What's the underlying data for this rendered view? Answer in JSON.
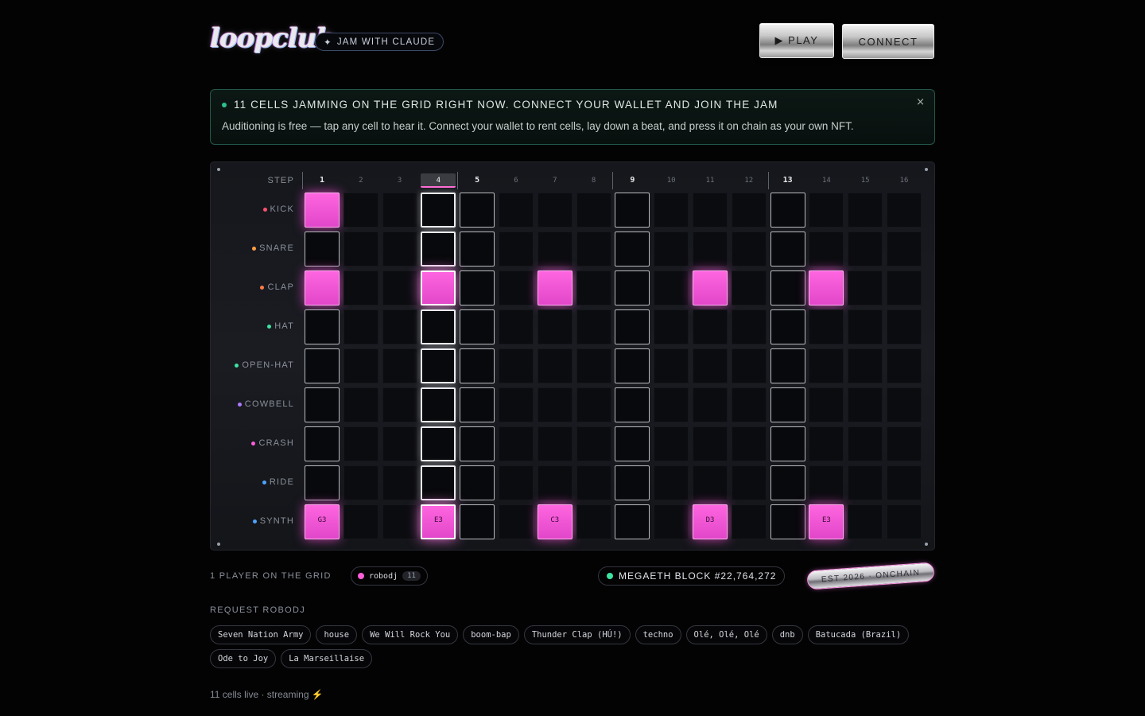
{
  "header": {
    "logo_text": "loopclub",
    "jam_pill_icon": "✦",
    "jam_pill_label": "JAM WITH CLAUDE",
    "play_label": "▶ PLAY",
    "connect_label": "CONNECT"
  },
  "banner": {
    "title": "11 CELLS JAMMING ON THE GRID RIGHT NOW. CONNECT YOUR WALLET AND JOIN THE JAM",
    "text": "Auditioning is free — tap any cell to hear it. Connect your wallet to rent cells, lay down a beat, and press it on chain as your own NFT.",
    "close_label": "×",
    "dot_color": "#2fbf8f"
  },
  "grid": {
    "step_label": "STEP",
    "steps": [
      "1",
      "2",
      "3",
      "4",
      "5",
      "6",
      "7",
      "8",
      "9",
      "10",
      "11",
      "12",
      "13",
      "14",
      "15",
      "16"
    ],
    "major_steps": [
      1,
      5,
      9,
      13
    ],
    "playhead_step": 4,
    "tracks": [
      {
        "name": "KICK",
        "color": "#ff4f6e"
      },
      {
        "name": "SNARE",
        "color": "#ff9f43"
      },
      {
        "name": "CLAP",
        "color": "#ff7a45"
      },
      {
        "name": "HAT",
        "color": "#3ee3a1"
      },
      {
        "name": "OPEN-HAT",
        "color": "#3ee3a1"
      },
      {
        "name": "COWBELL",
        "color": "#b07aff"
      },
      {
        "name": "CRASH",
        "color": "#ff5ed8"
      },
      {
        "name": "RIDE",
        "color": "#4fa3ff"
      },
      {
        "name": "SYNTH",
        "color": "#4fa3ff"
      }
    ],
    "active_cells": [
      {
        "track": 0,
        "step": 1
      },
      {
        "track": 2,
        "step": 1
      },
      {
        "track": 2,
        "step": 4
      },
      {
        "track": 2,
        "step": 7
      },
      {
        "track": 2,
        "step": 11
      },
      {
        "track": 2,
        "step": 14
      },
      {
        "track": 8,
        "step": 1,
        "note": "G3"
      },
      {
        "track": 8,
        "step": 4,
        "note": "E3"
      },
      {
        "track": 8,
        "step": 7,
        "note": "C3"
      },
      {
        "track": 8,
        "step": 11,
        "note": "D3"
      },
      {
        "track": 8,
        "step": 14,
        "note": "E3"
      }
    ]
  },
  "footer": {
    "players_label": "1 PLAYER ON THE GRID",
    "player_name": "robodj",
    "player_count": "11",
    "player_color": "#ff5ed8",
    "block_label": "MEGAETH BLOCK #22,764,272",
    "block_dot_color": "#3ee3a1",
    "est_badge": "EST 2026 · ONCHAIN",
    "request_label": "REQUEST ROBODJ",
    "requests": [
      "Seven Nation Army",
      "house",
      "We Will Rock You",
      "boom-bap",
      "Thunder Clap (HÚ!)",
      "techno",
      "Olé, Olé, Olé",
      "dnb",
      "Batucada (Brazil)",
      "Ode to Joy",
      "La Marseillaise"
    ],
    "status": "11 cells live · streaming ⚡"
  }
}
